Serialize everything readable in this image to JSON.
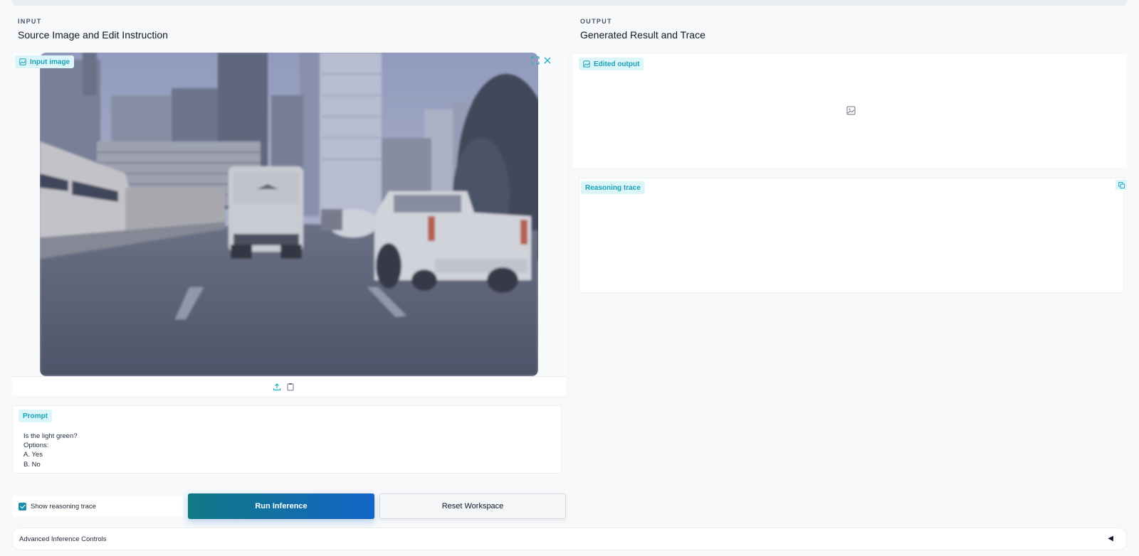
{
  "input": {
    "kicker": "INPUT",
    "heading": "Source Image and Edit Instruction",
    "image_label": "Input image",
    "prompt_label": "Prompt",
    "prompt_text": "Is the light green?\nOptions:\nA. Yes\nB. No"
  },
  "output": {
    "kicker": "OUTPUT",
    "heading": "Generated Result and Trace",
    "image_label": "Edited output",
    "trace_label": "Reasoning trace"
  },
  "controls": {
    "show_reasoning_label": "Show reasoning trace",
    "show_reasoning_checked": true,
    "run_label": "Run Inference",
    "reset_label": "Reset Workspace",
    "advanced_label": "Advanced Inference Controls"
  },
  "icons": {
    "badge": "image-icon",
    "fullscreen": "fullscreen-icon",
    "close": "close-icon",
    "upload": "upload-icon",
    "clipboard": "clipboard-icon",
    "placeholder": "image-placeholder-icon",
    "copy": "copy-icon",
    "caret": "caret-left-icon"
  },
  "colors": {
    "accent": "#1aa3b7",
    "badge_bg": "#dbf5f9",
    "run_gradient_start": "#117a84",
    "run_gradient_end": "#1364c8"
  }
}
